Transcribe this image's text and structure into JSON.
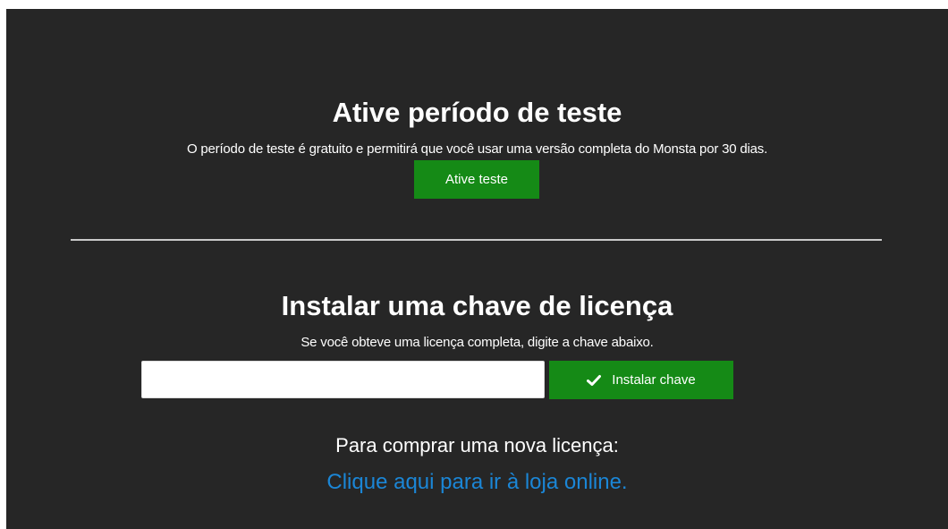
{
  "trial": {
    "title": "Ative período de teste",
    "description": "O período de teste é gratuito e permitirá que você usar uma versão completa do Monsta por 30 dias.",
    "button_label": "Ative teste"
  },
  "license": {
    "title": "Instalar uma chave de licença",
    "description": "Se você obteve uma licença completa, digite a chave abaixo.",
    "key_value": "",
    "key_placeholder": "",
    "install_button_label": "Instalar chave",
    "install_button_icon": "check-icon"
  },
  "purchase": {
    "label": "Para comprar uma nova licença:",
    "link_text": "Clique aqui para ir à loja online."
  },
  "colors": {
    "background": "#262626",
    "button_green": "#158a16",
    "link_blue": "#1b86d6",
    "divider": "#c9c9c9"
  }
}
